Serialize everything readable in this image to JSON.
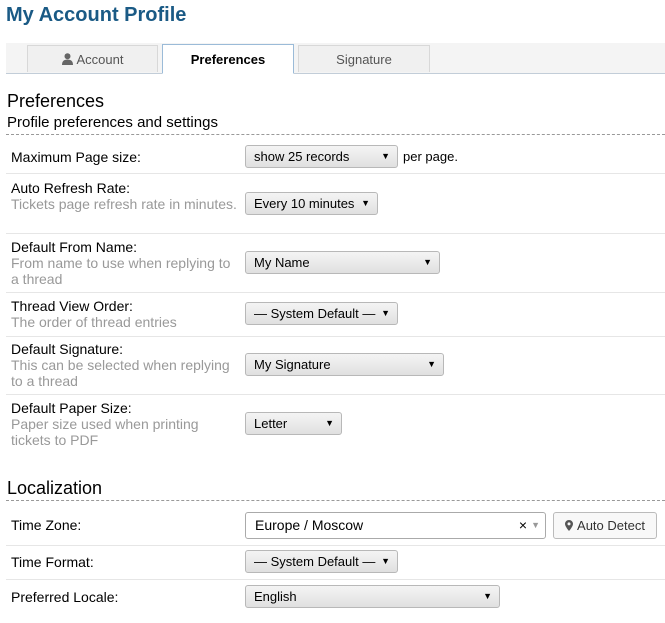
{
  "page": {
    "title": "My Account Profile"
  },
  "tabs": [
    {
      "label": "Account",
      "icon": "user-icon"
    },
    {
      "label": "Preferences",
      "active": true
    },
    {
      "label": "Signature"
    }
  ],
  "preferences": {
    "title": "Preferences",
    "subtitle": "Profile preferences and settings",
    "max_page_size": {
      "label": "Maximum Page size:",
      "value": "show 25 records",
      "suffix": "per page."
    },
    "auto_refresh": {
      "label": "Auto Refresh Rate:",
      "hint": "Tickets page refresh rate in minutes.",
      "value": "Every 10 minutes"
    },
    "from_name": {
      "label": "Default From Name:",
      "hint": "From name to use when replying to a thread",
      "value": "My Name"
    },
    "thread_order": {
      "label": "Thread View Order:",
      "hint": "The order of thread entries",
      "value": "— System Default —"
    },
    "signature": {
      "label": "Default Signature:",
      "hint": "This can be selected when replying to a thread",
      "value": "My Signature"
    },
    "paper_size": {
      "label": "Default Paper Size:",
      "hint": "Paper size used when printing tickets to PDF",
      "value": "Letter"
    }
  },
  "localization": {
    "title": "Localization",
    "timezone": {
      "label": "Time Zone:",
      "value": "Europe / Moscow",
      "clear_glyph": "×",
      "auto_detect_label": "Auto Detect"
    },
    "time_format": {
      "label": "Time Format:",
      "value": "— System Default —"
    },
    "locale": {
      "label": "Preferred Locale:",
      "value": "English"
    }
  },
  "icons": {
    "dropdown": "▼"
  },
  "colors": {
    "title": "#1a5a85",
    "hint": "#999999",
    "active_tab_border": "#9bbbd8"
  }
}
